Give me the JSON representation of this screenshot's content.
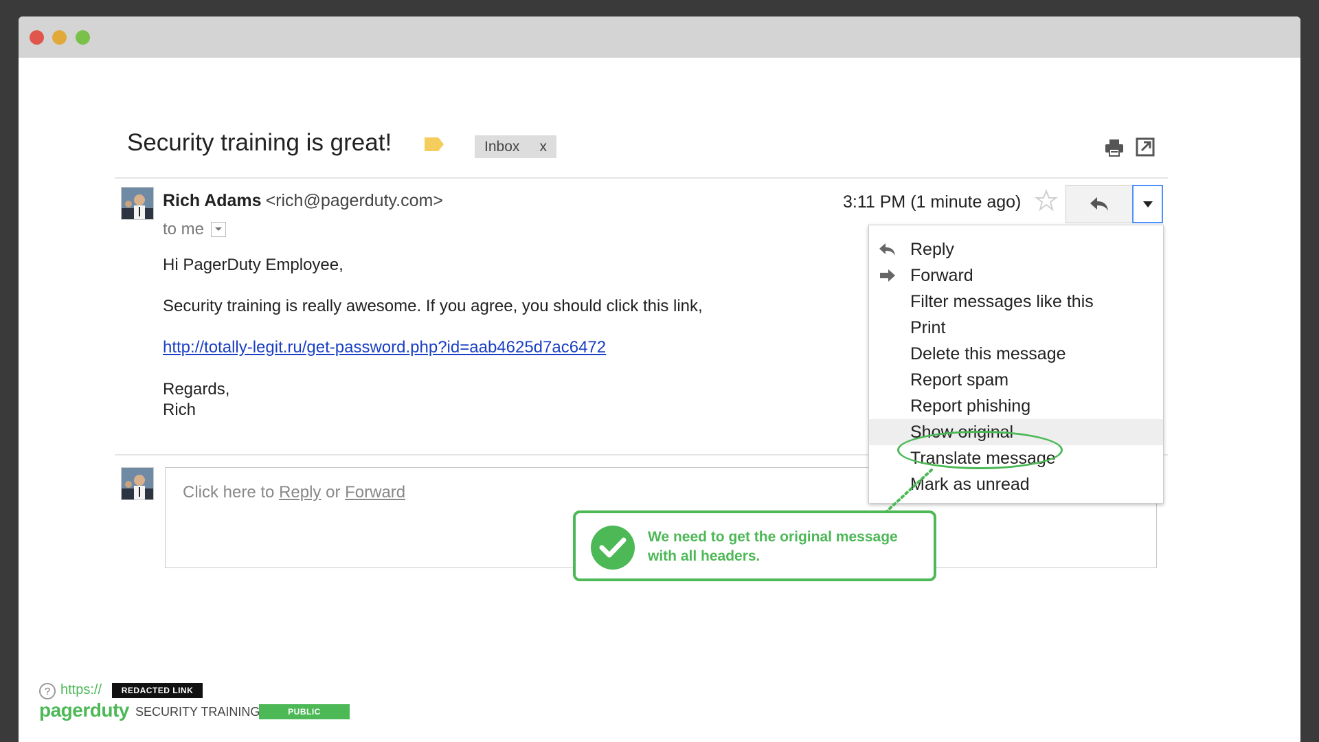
{
  "email": {
    "subject": "Security training is great!",
    "label_chip": "Inbox",
    "label_close": "x",
    "sender_name": "Rich Adams",
    "sender_email": "<rich@pagerduty.com>",
    "to": "to me",
    "time": "3:11 PM (1 minute ago)",
    "body": {
      "greeting": "Hi PagerDuty Employee,",
      "line1": "Security training is really awesome. If you agree, you should click this link,",
      "link": "http://totally-legit.ru/get-password.php?id=aab4625d7ac6472",
      "signoff": "Regards,",
      "signature": "Rich"
    },
    "reply_box": {
      "prefix": "Click here to ",
      "reply": "Reply",
      "or": " or ",
      "forward": "Forward"
    }
  },
  "menu": {
    "items": [
      {
        "label": "Reply",
        "icon": "reply-icon"
      },
      {
        "label": "Forward",
        "icon": "forward-icon"
      },
      {
        "label": "Filter messages like this",
        "icon": ""
      },
      {
        "label": "Print",
        "icon": ""
      },
      {
        "label": "Delete this message",
        "icon": ""
      },
      {
        "label": "Report spam",
        "icon": ""
      },
      {
        "label": "Report phishing",
        "icon": ""
      },
      {
        "label": "Show original",
        "icon": "",
        "highlighted": true
      },
      {
        "label": "Translate message",
        "icon": ""
      },
      {
        "label": "Mark as unread",
        "icon": ""
      }
    ]
  },
  "annotation": {
    "text": "We need to get the original message with all headers.",
    "color": "#4cb856"
  },
  "footer": {
    "help": "?",
    "url_prefix": "https://",
    "redacted": "REDACTED LINK",
    "logo": "pagerduty",
    "title": "SECURITY TRAINING",
    "badge": "PUBLIC"
  },
  "colors": {
    "accent_green": "#4cb856",
    "link_blue": "#1a3fc4",
    "focus_blue": "#4d90fe"
  }
}
